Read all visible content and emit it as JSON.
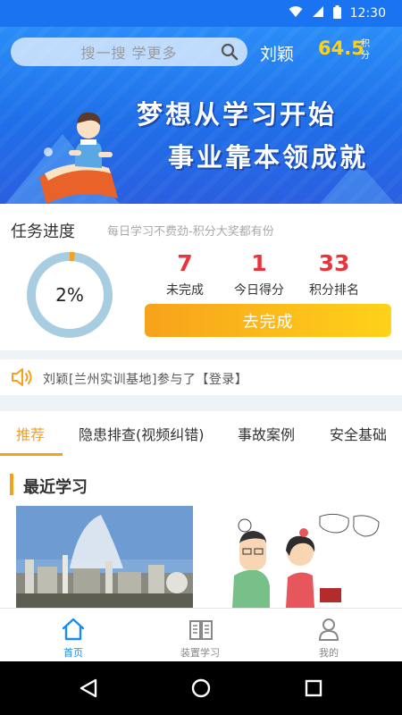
{
  "status_bar": {
    "time": "12:30"
  },
  "header": {
    "search_placeholder": "搜一搜 学更多",
    "user_name": "刘颖",
    "points": "64.5",
    "points_unit": "积分"
  },
  "banner": {
    "slogan_line1": "梦想从学习开始",
    "slogan_line2": "事业靠本领成就"
  },
  "task_progress": {
    "title": "任务进度",
    "subtitle": "每日学习不费劲-积分大奖都有份",
    "progress_percent": 2,
    "progress_label": "2%",
    "stats": [
      {
        "value": "7",
        "label": "未完成"
      },
      {
        "value": "1",
        "label": "今日得分"
      },
      {
        "value": "33",
        "label": "积分排名"
      }
    ],
    "button_label": "去完成"
  },
  "notice": {
    "text": "刘颖[兰州实训基地]参与了【登录】"
  },
  "tabs": [
    {
      "label": "推荐",
      "active": true
    },
    {
      "label": "隐患排查(视频纠错)",
      "active": false
    },
    {
      "label": "事故案例",
      "active": false
    },
    {
      "label": "安全基础",
      "active": false
    }
  ],
  "recent": {
    "title": "最近学习"
  },
  "bottom_nav": [
    {
      "label": "首页",
      "icon": "home-icon",
      "active": true
    },
    {
      "label": "装置学习",
      "icon": "book-icon",
      "active": false
    },
    {
      "label": "我的",
      "icon": "person-icon",
      "active": false
    }
  ],
  "colors": {
    "brand_blue": "#1a73f0",
    "accent_orange": "#f5a11b",
    "stat_red": "#e8353b",
    "points_yellow": "#ffd21a"
  }
}
